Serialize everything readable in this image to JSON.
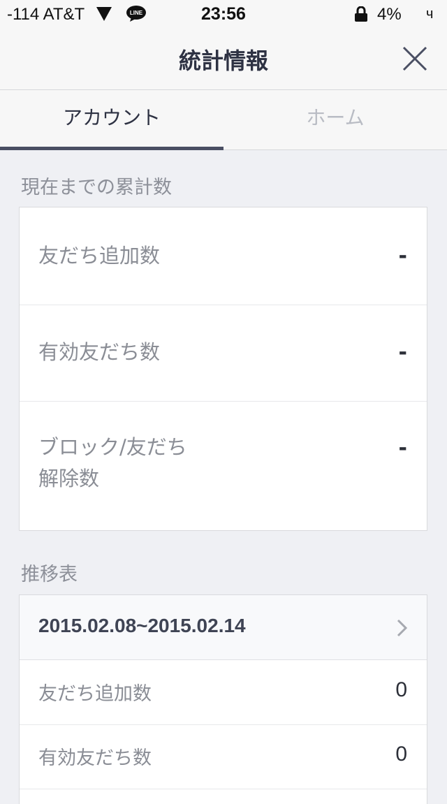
{
  "status_bar": {
    "carrier": "-114 AT&T",
    "time": "23:56",
    "battery": "4%",
    "extra": "ч",
    "line_badge": "LINE"
  },
  "header": {
    "title": "統計情報"
  },
  "tabs": [
    {
      "label": "アカウント",
      "active": true
    },
    {
      "label": "ホーム",
      "active": false
    }
  ],
  "cumulative": {
    "section_label": "現在までの累計数",
    "rows": [
      {
        "label": "友だち追加数",
        "value": "-"
      },
      {
        "label": "有効友だち数",
        "value": "-"
      },
      {
        "label_line1": "ブロック/友だち",
        "label_line2": "解除数",
        "value": "-"
      }
    ]
  },
  "trend": {
    "section_label": "推移表",
    "date_range": "2015.02.08~2015.02.14",
    "rows": [
      {
        "label": "友だち追加数",
        "value": "0"
      },
      {
        "label": "有効友だち数",
        "value": "0"
      }
    ]
  }
}
